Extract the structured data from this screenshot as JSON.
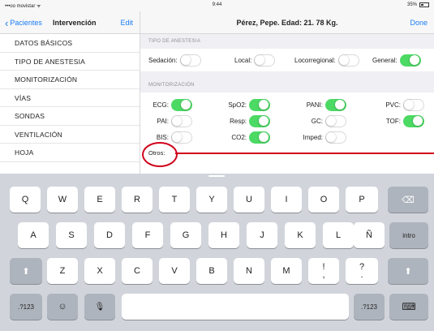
{
  "status_bar": {
    "carrier": "•••oo movistar ᯤ",
    "time": "9:44",
    "battery": "35%"
  },
  "master": {
    "back_label": "Pacientes",
    "title": "Intervención",
    "edit_label": "Edit",
    "items": [
      "DATOS BÁSICOS",
      "TIPO DE ANESTESIA",
      "MONITORIZACIÓN",
      "VÍAS",
      "SONDAS",
      "VENTILACIÓN",
      "HOJA"
    ]
  },
  "detail": {
    "patient_title": "Pérez, Pepe. Edad: 21. 78 Kg.",
    "done_label": "Done",
    "anesthesia": {
      "header": "TIPO DE ANESTESIA",
      "options": [
        {
          "label": "Sedación:",
          "on": false
        },
        {
          "label": "Local:",
          "on": false
        },
        {
          "label": "Locorregional:",
          "on": false
        },
        {
          "label": "General:",
          "on": true
        }
      ]
    },
    "monitoring": {
      "header": "MONITORIZACIÓN",
      "items": [
        {
          "label": "ECG:",
          "on": true
        },
        {
          "label": "SpO2:",
          "on": true
        },
        {
          "label": "PANI:",
          "on": true
        },
        {
          "label": "PVC:",
          "on": false
        },
        {
          "label": "PAI:",
          "on": false
        },
        {
          "label": "Resp:",
          "on": true
        },
        {
          "label": "GC:",
          "on": false
        },
        {
          "label": "TOF:",
          "on": true
        },
        {
          "label": "BIS:",
          "on": false
        },
        {
          "label": "CO2:",
          "on": true
        },
        {
          "label": "Imped:",
          "on": false
        }
      ]
    },
    "otros": {
      "label": "Otros:",
      "value": ""
    }
  },
  "keyboard": {
    "row1": [
      "Q",
      "W",
      "E",
      "R",
      "T",
      "Y",
      "U",
      "I",
      "O",
      "P"
    ],
    "row2": [
      "A",
      "S",
      "D",
      "F",
      "G",
      "H",
      "J",
      "K",
      "L",
      "Ñ"
    ],
    "row3": [
      "Z",
      "X",
      "C",
      "V",
      "B",
      "N",
      "M"
    ],
    "punct1": [
      "!",
      ","
    ],
    "punct2": [
      "?",
      "."
    ],
    "return_label": "intro",
    "numbers_label": ".?123",
    "backspace_icon": "⌫",
    "shift_icon": "⬆",
    "emoji_icon": "☺",
    "mic_icon": "🎙",
    "hide_icon": "⌨"
  },
  "colors": {
    "accent": "#1a7cf5",
    "switch_on": "#4cd964",
    "annotation": "#d0021b"
  }
}
